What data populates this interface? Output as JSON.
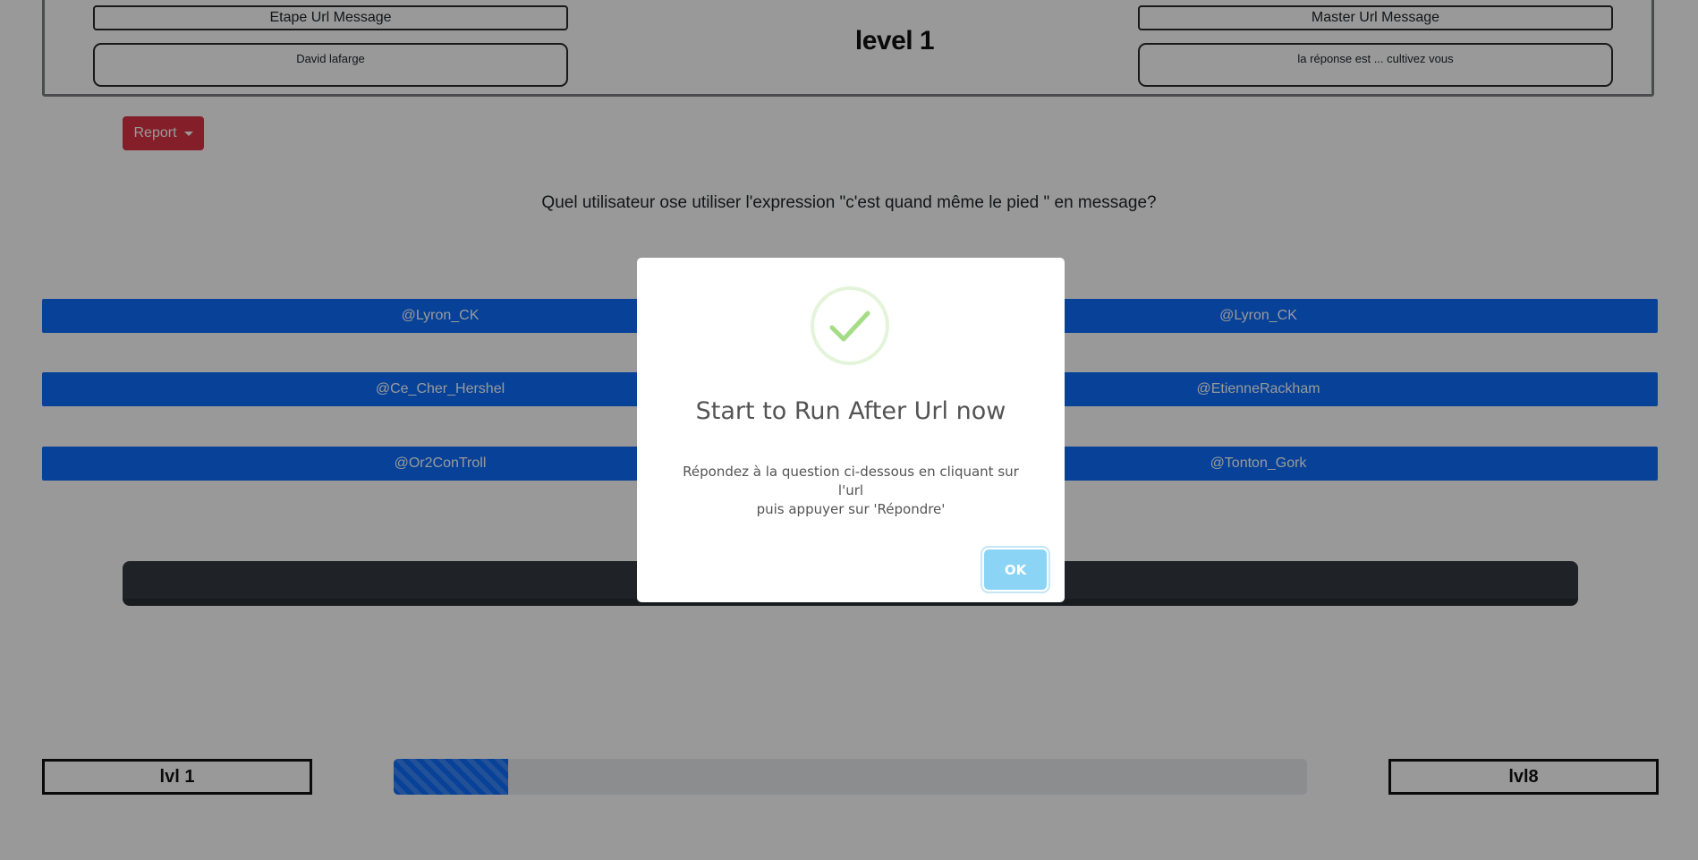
{
  "header": {
    "etape_label": "Etape Url Message",
    "etape_value": "David lafarge",
    "level_title": "level 1",
    "master_label": "Master Url Message",
    "master_value": "la réponse est ... cultivez vous"
  },
  "report_button": {
    "label": "Report"
  },
  "question": "Quel utilisateur ose utiliser l'expression \"c'est quand même le pied \" en message?",
  "answers": [
    {
      "label": "@Lyron_CK"
    },
    {
      "label": "@Lyron_CK"
    },
    {
      "label": "@Ce_Cher_Hershel"
    },
    {
      "label": "@EtienneRackham"
    },
    {
      "label": "@Or2ConTroll"
    },
    {
      "label": "@Tonton_Gork"
    }
  ],
  "progress": {
    "start_label": "lvl 1",
    "end_label": "lvl8",
    "fill_percent": 12.5
  },
  "modal": {
    "title": "Start to Run After Url now",
    "text_line1": "Répondez à la question ci-dessous en cliquant sur l'url",
    "text_line2": "puis appuyer sur 'Répondre'",
    "ok_label": "OK",
    "icon": "success-check-icon"
  },
  "colors": {
    "primary": "#0d6efd",
    "danger": "#dc3545",
    "dark": "#343a40",
    "ok_button": "#8cd4f5",
    "success_check": "#a5dc86"
  }
}
